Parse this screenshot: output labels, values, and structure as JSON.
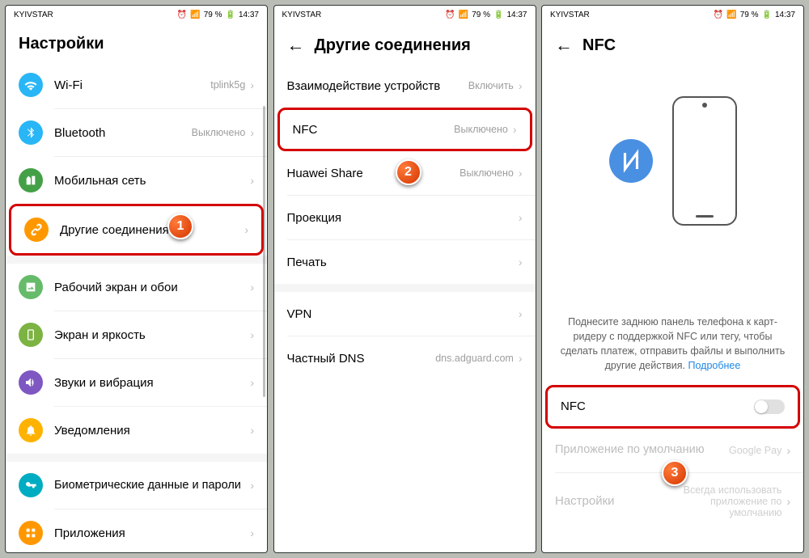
{
  "status": {
    "carrier": "KYIVSTAR",
    "battery": "79 %",
    "time": "14:37"
  },
  "screen1": {
    "title": "Настройки",
    "items": [
      {
        "label": "Wi-Fi",
        "value": "tplink5g",
        "color": "#29b6f6",
        "icon": "wifi"
      },
      {
        "label": "Bluetooth",
        "value": "Выключено",
        "color": "#29b6f6",
        "icon": "bluetooth"
      },
      {
        "label": "Мобильная сеть",
        "value": "",
        "color": "#43a047",
        "icon": "sim"
      },
      {
        "label": "Другие соединения",
        "value": "",
        "color": "#ff9800",
        "icon": "link"
      },
      {
        "label": "Рабочий экран и обои",
        "value": "",
        "color": "#66bb6a",
        "icon": "image"
      },
      {
        "label": "Экран и яркость",
        "value": "",
        "color": "#7cb342",
        "icon": "phone"
      },
      {
        "label": "Звуки и вибрация",
        "value": "",
        "color": "#7e57c2",
        "icon": "sound"
      },
      {
        "label": "Уведомления",
        "value": "",
        "color": "#ffb300",
        "icon": "bell"
      },
      {
        "label": "Биометрические данные и пароли",
        "value": "",
        "color": "#00acc1",
        "icon": "key"
      },
      {
        "label": "Приложения",
        "value": "",
        "color": "#ff9800",
        "icon": "apps"
      }
    ]
  },
  "screen2": {
    "title": "Другие соединения",
    "items": [
      {
        "label": "Взаимодействие устройств",
        "value": "Включить"
      },
      {
        "label": "NFC",
        "value": "Выключено"
      },
      {
        "label": "Huawei Share",
        "value": "Выключено"
      },
      {
        "label": "Проекция",
        "value": ""
      },
      {
        "label": "Печать",
        "value": ""
      },
      {
        "label": "VPN",
        "value": ""
      },
      {
        "label": "Частный DNS",
        "value": "dns.adguard.com"
      }
    ]
  },
  "screen3": {
    "title": "NFC",
    "help_text": "Поднесите заднюю панель телефона к карт-ридеру с поддержкой NFC или тегу, чтобы сделать платеж, отправить файлы и выполнить другие действия. ",
    "help_link": "Подробнее",
    "toggle_label": "NFC",
    "app_label": "Приложение по умолчанию",
    "app_value": "Google Pay",
    "settings_label": "Настройки",
    "settings_value": "Всегда использовать приложение по умолчанию"
  },
  "markers": [
    "1",
    "2",
    "3"
  ]
}
